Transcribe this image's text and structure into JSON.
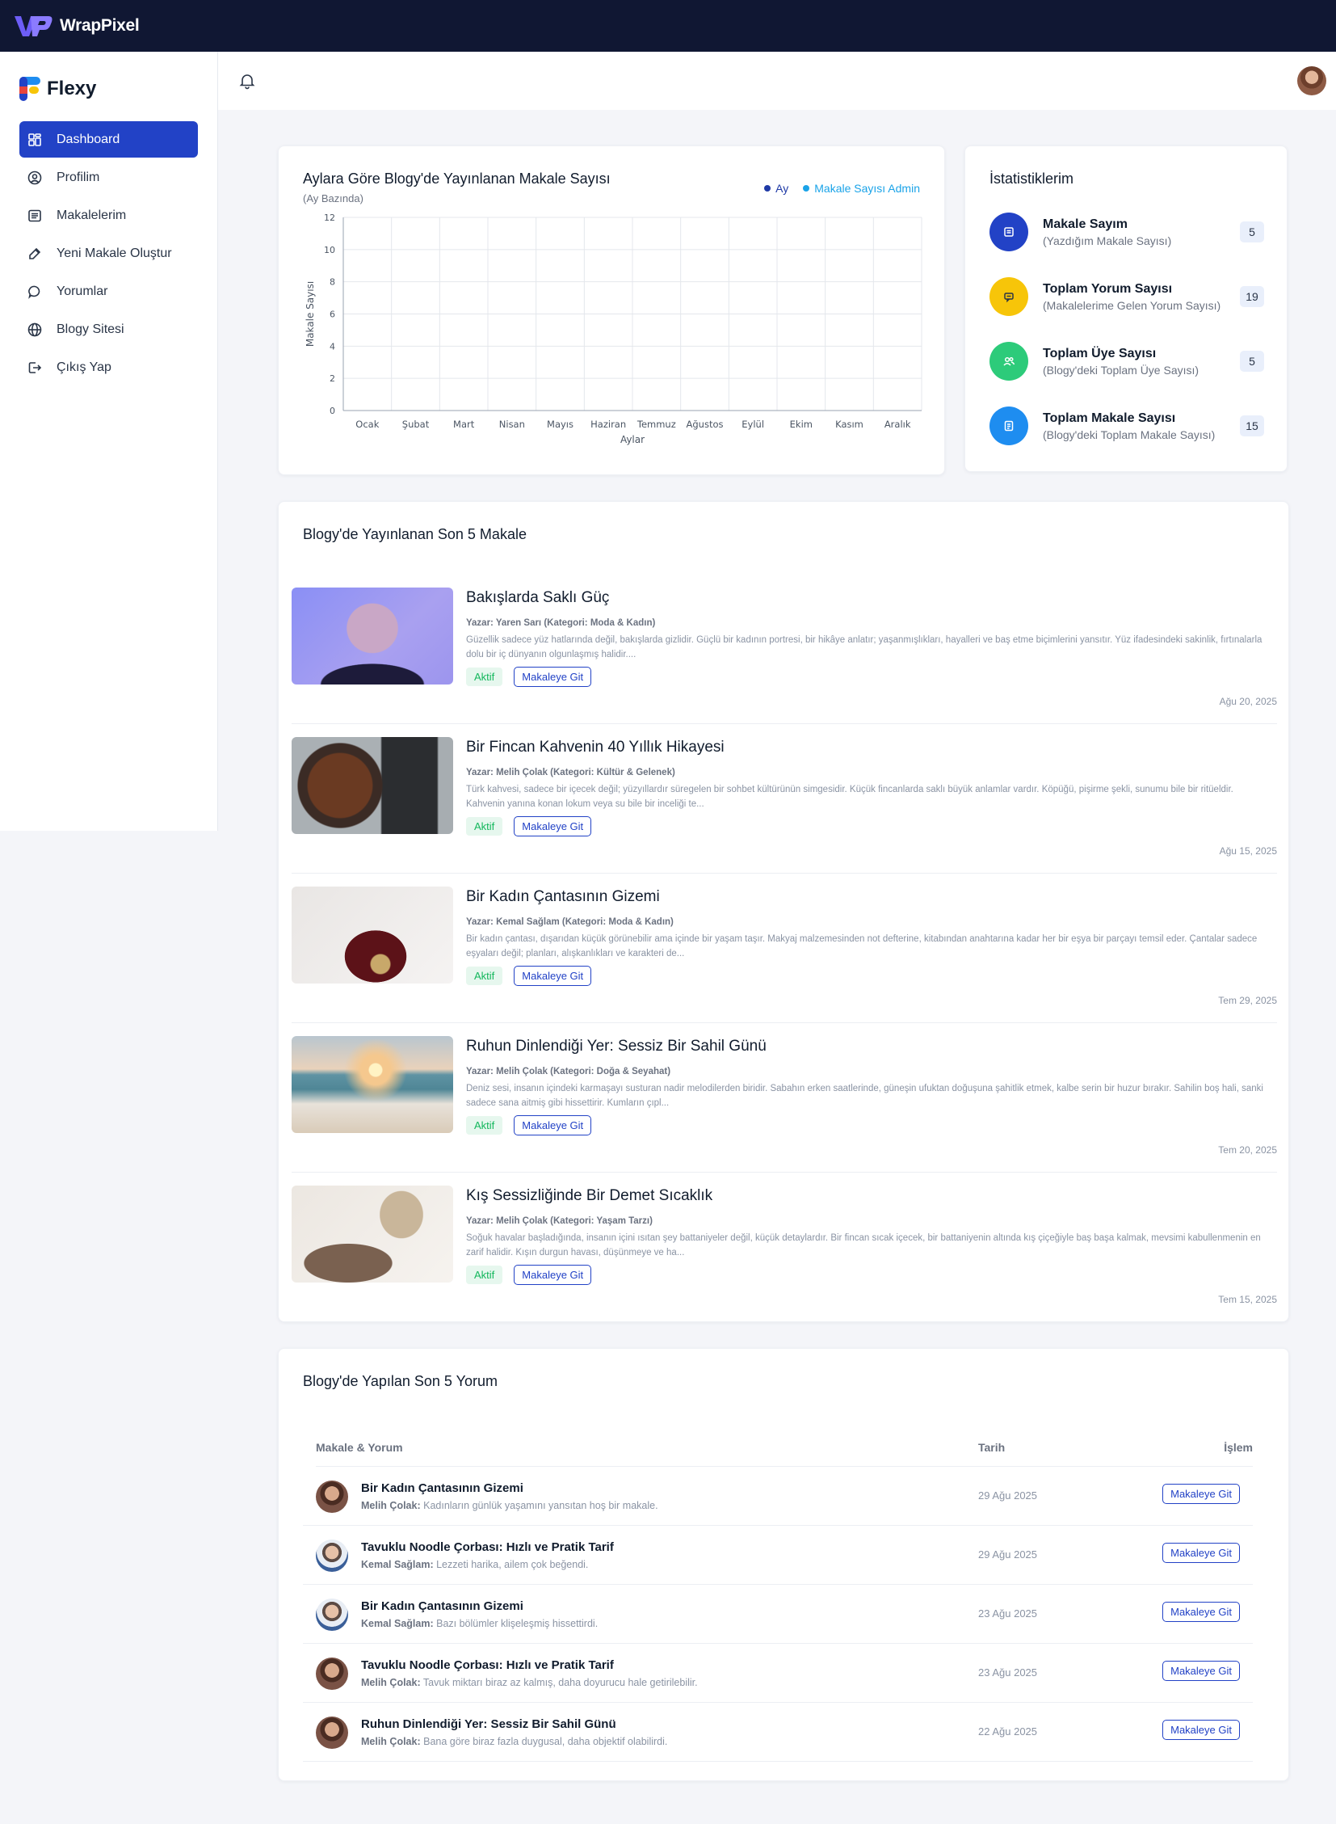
{
  "topbar": {
    "brand": "WrapPixel"
  },
  "sidebar": {
    "logo_text": "Flexy",
    "items": [
      {
        "label": "Dashboard",
        "icon": "dashboard-icon"
      },
      {
        "label": "Profilim",
        "icon": "user-circle-icon"
      },
      {
        "label": "Makalelerim",
        "icon": "list-icon"
      },
      {
        "label": "Yeni Makale Oluştur",
        "icon": "edit-icon"
      },
      {
        "label": "Yorumlar",
        "icon": "comment-icon"
      },
      {
        "label": "Blogy Sitesi",
        "icon": "globe-icon"
      },
      {
        "label": "Çıkış Yap",
        "icon": "logout-icon"
      }
    ]
  },
  "chart_card": {
    "title": "Aylara Göre Blogy'de Yayınlanan Makale Sayısı",
    "subtitle": "(Ay Bazında)"
  },
  "chart_data": {
    "type": "line",
    "categories": [
      "Ocak",
      "Şubat",
      "Mart",
      "Nisan",
      "Mayıs",
      "Haziran",
      "Temmuz",
      "Ağustos",
      "Eylül",
      "Ekim",
      "Kasım",
      "Aralık"
    ],
    "series": [
      {
        "name": "Ay",
        "values": []
      },
      {
        "name": "Makale Sayısı Admin",
        "values": []
      }
    ],
    "xlabel": "Aylar",
    "ylabel": "Makale Sayısı",
    "ylim": [
      0,
      12
    ],
    "yticks": [
      0,
      2,
      4,
      6,
      8,
      10,
      12
    ],
    "grid": true,
    "legend": "top-right",
    "colors": [
      "#1f3aa6",
      "#1aa3e8"
    ]
  },
  "stats": {
    "title": "İstatistiklerim",
    "items": [
      {
        "title": "Makale Sayım",
        "sub": "(Yazdığım Makale Sayısı)",
        "value": "5",
        "color": "#2242c6",
        "icon": "document-icon"
      },
      {
        "title": "Toplam Yorum Sayısı",
        "sub": "(Makalelerime Gelen Yorum Sayısı)",
        "value": "19",
        "color": "#f7c509",
        "icon": "message-icon"
      },
      {
        "title": "Toplam Üye Sayısı",
        "sub": "(Blogy'deki Toplam Üye Sayısı)",
        "value": "5",
        "color": "#2dcb7a",
        "icon": "users-icon"
      },
      {
        "title": "Toplam Makale Sayısı",
        "sub": "(Blogy'deki Toplam Makale Sayısı)",
        "value": "15",
        "color": "#1e8df0",
        "icon": "file-icon"
      }
    ]
  },
  "articles": {
    "title": "Blogy'de Yayınlanan Son 5 Makale",
    "status_label": "Aktif",
    "button_label": "Makaleye Git",
    "items": [
      {
        "title": "Bakışlarda Saklı Güç",
        "meta": "Yazar: Yaren Sarı (Kategori: Moda & Kadın)",
        "body": "Güzellik sadece yüz hatlarında değil, bakışlarda gizlidir. Güçlü bir kadının portresi, bir hikâye anlatır; yaşanmışlıkları, hayalleri ve baş etme biçimlerini yansıtır. Yüz ifadesindeki sakinlik, fırtınalarla dolu bir iç dünyanın olgunlaşmış halidir....",
        "date": "Ağu 20, 2025"
      },
      {
        "title": "Bir Fincan Kahvenin 40 Yıllık Hikayesi",
        "meta": "Yazar: Melih Çolak (Kategori: Kültür & Gelenek)",
        "body": "Türk kahvesi, sadece bir içecek değil; yüzyıllardır süregelen bir sohbet kültürünün simgesidir. Küçük fincanlarda saklı büyük anlamlar vardır. Köpüğü, pişirme şekli, sunumu bile bir ritüeldir. Kahvenin yanına konan lokum veya su bile bir inceliği te...",
        "date": "Ağu 15, 2025"
      },
      {
        "title": "Bir Kadın Çantasının Gizemi",
        "meta": "Yazar: Kemal Sağlam (Kategori: Moda & Kadın)",
        "body": "Bir kadın çantası, dışarıdan küçük görünebilir ama içinde bir yaşam taşır. Makyaj malzemesinden not defterine, kitabından anahtarına kadar her bir eşya bir parçayı temsil eder. Çantalar sadece eşyaları değil; planları, alışkanlıkları ve karakteri de...",
        "date": "Tem 29, 2025"
      },
      {
        "title": "Ruhun Dinlendiği Yer: Sessiz Bir Sahil Günü",
        "meta": "Yazar: Melih Çolak (Kategori: Doğa & Seyahat)",
        "body": "Deniz sesi, insanın içindeki karmaşayı susturan nadir melodilerden biridir. Sabahın erken saatlerinde, güneşin ufuktan doğuşuna şahitlik etmek, kalbe serin bir huzur bırakır. Sahilin boş hali, sanki sadece sana aitmiş gibi hissettirir. Kumların çıpl...",
        "date": "Tem 20, 2025"
      },
      {
        "title": "Kış Sessizliğinde Bir Demet Sıcaklık",
        "meta": "Yazar: Melih Çolak (Kategori: Yaşam Tarzı)",
        "body": "Soğuk havalar başladığında, insanın içini ısıtan şey battaniyeler değil, küçük detaylardır. Bir fincan sıcak içecek, bir battaniyenin altında kış çiçeğiyle baş başa kalmak, mevsimi kabullenmenin en zarif halidir. Kışın durgun havası, düşünmeye ve ha...",
        "date": "Tem 15, 2025"
      }
    ]
  },
  "comments": {
    "title": "Blogy'de Yapılan Son 5 Yorum",
    "headers": {
      "article": "Makale & Yorum",
      "date": "Tarih",
      "action": "İşlem"
    },
    "button_label": "Makaleye Git",
    "items": [
      {
        "article": "Bir Kadın Çantasının Gizemi",
        "author": "Melih Çolak:",
        "text": "Kadınların günlük yaşamını yansıtan hoş bir makale.",
        "date": "29 Ağu 2025"
      },
      {
        "article": "Tavuklu Noodle Çorbası: Hızlı ve Pratik Tarif",
        "author": "Kemal Sağlam:",
        "text": "Lezzeti harika, ailem çok beğendi.",
        "date": "29 Ağu 2025"
      },
      {
        "article": "Bir Kadın Çantasının Gizemi",
        "author": "Kemal Sağlam:",
        "text": "Bazı bölümler klişeleşmiş hissettirdi.",
        "date": "23 Ağu 2025"
      },
      {
        "article": "Tavuklu Noodle Çorbası: Hızlı ve Pratik Tarif",
        "author": "Melih Çolak:",
        "text": "Tavuk miktarı biraz az kalmış, daha doyurucu hale getirilebilir.",
        "date": "23 Ağu 2025"
      },
      {
        "article": "Ruhun Dinlendiği Yer: Sessiz Bir Sahil Günü",
        "author": "Melih Çolak:",
        "text": "Bana göre biraz fazla duygusal, daha objektif olabilirdi.",
        "date": "22 Ağu 2025"
      }
    ]
  }
}
